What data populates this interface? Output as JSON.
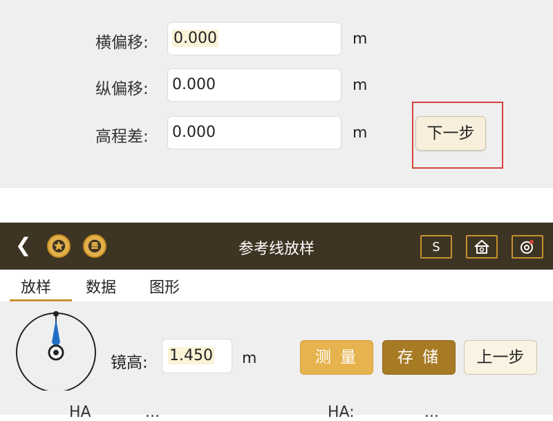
{
  "form": {
    "rows": [
      {
        "label": "横偏移:",
        "value": "0.000",
        "unit": "m"
      },
      {
        "label": "纵偏移:",
        "value": "0.000",
        "unit": "m"
      },
      {
        "label": "高程差:",
        "value": "0.000",
        "unit": "m"
      }
    ],
    "next_label": "下一步",
    "highlight_color": "#d9413b"
  },
  "app": {
    "title": "参考线放样",
    "back_icon": "chevron-left-icon",
    "icons": [
      "star-icon",
      "database-icon"
    ],
    "toolbar": {
      "s_label": "S",
      "home_icon": "home-icon",
      "target_icon": "target-icon"
    },
    "tabs": [
      "放样",
      "数据",
      "图形"
    ],
    "active_tab": "放样",
    "mirror": {
      "label": "镜高:",
      "value": "1.450",
      "unit": "m"
    },
    "buttons": {
      "measure": "测 量",
      "store": "存 储",
      "prev": "上一步"
    },
    "bottom_cut": {
      "left_label": "HA",
      "left_value": "...",
      "right_label": "HA:",
      "right_value": "..."
    },
    "colors": {
      "titlebar": "#3d3423",
      "accent": "#c8902f",
      "measure": "#e6b34e",
      "store": "#a77a24"
    }
  }
}
